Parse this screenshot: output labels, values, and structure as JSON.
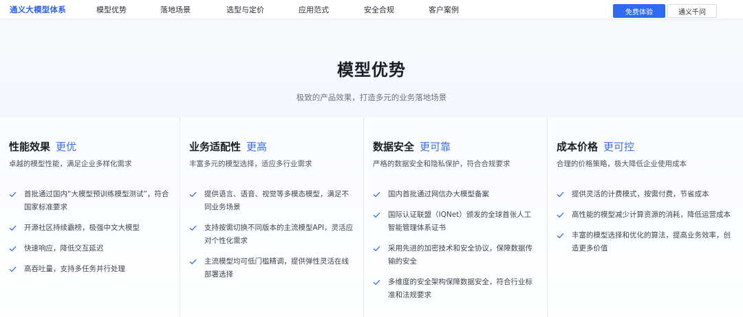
{
  "nav": {
    "brand": "通义大模型体系",
    "links": [
      {
        "label": "模型优势",
        "key": "model-advantage"
      },
      {
        "label": "落地场景",
        "key": "scenarios"
      },
      {
        "label": "选型与定价",
        "key": "pricing"
      },
      {
        "label": "应用范式",
        "key": "paradigms"
      },
      {
        "label": "安全合规",
        "key": "security"
      },
      {
        "label": "客户案例",
        "key": "cases"
      }
    ],
    "primary_button": "免费体验",
    "secondary_button": "通义千问"
  },
  "section": {
    "title": "模型优势",
    "subtitle": "极致的产品效果，打造多元的业务落地场景"
  },
  "cards": [
    {
      "key": "performance",
      "title": "性能效果",
      "highlight": "更优",
      "desc": "卓越的模型性能，满足企业多样化需求",
      "items": [
        "首批通过国内“大模型预训练模型测试”，符合国家标准要求",
        "开源社区持续霸榜，极强中文大模型",
        "快速响应，降低交互延迟",
        "高吞吐量，支持多任务并行处理"
      ]
    },
    {
      "key": "adaptability",
      "title": "业务适配性",
      "highlight": "更高",
      "desc": "丰富多元的模型选择，适应多行业需求",
      "items": [
        "提供语言、语音、视觉等多模态模型，满足不同业务场景",
        "支持按需切换不同版本的主流模型API，灵活应对个性化需求",
        "主流模型均可低门槛精调，提供弹性灵活在线部署选择"
      ]
    },
    {
      "key": "data-security",
      "title": "数据安全",
      "highlight": "更可靠",
      "desc": "严格的数据安全和隐私保护，符合合规要求",
      "items": [
        "国内首批通过网信办大模型备案",
        "国际认证联盟（IQNet）颁发的全球首张人工智能管理体系证书",
        "采用先进的加密技术和安全协议，保障数据传输的安全",
        "多维度的安全架构保障数据安全，符合行业标准和法规要求"
      ]
    },
    {
      "key": "cost",
      "title": "成本价格",
      "highlight": "更可控",
      "desc": "合理的价格策略，极大降低企业使用成本",
      "items": [
        "提供灵活的计费模式，按需付费，节省成本",
        "高性能的模型减少计算资源的消耗，降低运营成本",
        "丰富的模型选择和优化的算法，提高业务效率，创造更多价值"
      ]
    }
  ],
  "colors": {
    "brand": "#2e63e6",
    "accent": "#3b6ff0",
    "primary_button_bg": "#2f6bf0",
    "check_icon": "#3b6ff0"
  },
  "icons": {
    "bullet": "check-icon"
  }
}
